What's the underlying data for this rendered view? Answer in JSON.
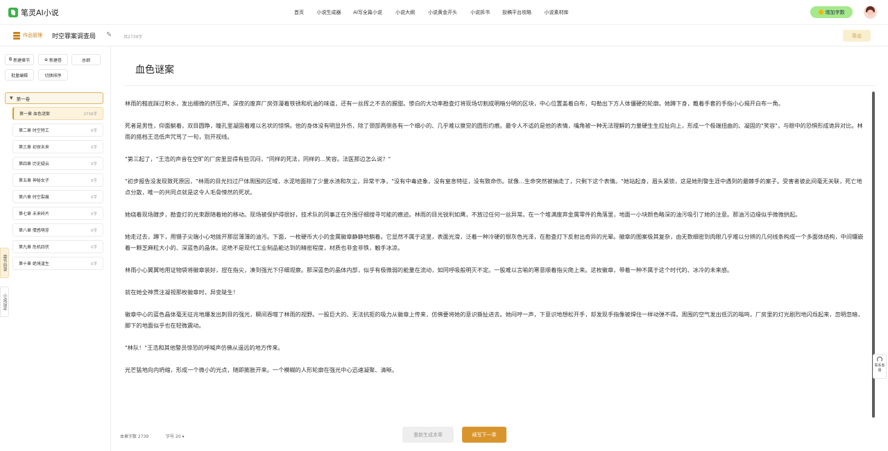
{
  "app": {
    "name": "笔灵AI小说"
  },
  "nav": {
    "items": [
      "首页",
      "小说生成器",
      "AI写全篇小说",
      "小说大纲",
      "小说黄金开头",
      "小说拆书",
      "投稿平台攻略",
      "小说素材库"
    ],
    "upgrade_label": "增加字数"
  },
  "subheader": {
    "crumb": "作品管理",
    "book_title": "时空罪案调查局",
    "total": "共2739字",
    "export": "导出"
  },
  "sidebar": {
    "buttons": [
      "新建章节",
      "新建卷",
      "总纲",
      "批量编辑",
      "切换排序"
    ],
    "volume": "第一卷",
    "chapters": [
      {
        "name": "第一章 血色谜案",
        "count": "2739字"
      },
      {
        "name": "第二章 时空特工",
        "count": "0字"
      },
      {
        "name": "第三章 初探未来",
        "count": "0字"
      },
      {
        "name": "第四章 历史疑云",
        "count": "0字"
      },
      {
        "name": "第五章 神秘女子",
        "count": "0字"
      },
      {
        "name": "第六章 时空裂痕",
        "count": "0字"
      },
      {
        "name": "第七章 未来碎片",
        "count": "0字"
      },
      {
        "name": "第八章 情感萌芽",
        "count": "0字"
      },
      {
        "name": "第九章 危机四伏",
        "count": "0字"
      },
      {
        "name": "第十章 绝境逢生",
        "count": "0字"
      }
    ],
    "tabs": [
      "章节目录",
      "小说设定"
    ]
  },
  "editor": {
    "title": "血色谜案",
    "paragraphs": [
      "林雨的鞋底踩过积水，发出细微的挤压声。深夜的废弃厂房弥漫着铁锈和机油的味道，还有一丝挥之不去的腥甜。惨白的大功率勘查灯将现场切割成明暗分明的区块，中心位置盖着白布，勾勒出下方人体僵硬的轮廓。她蹲下身，戴着手套的手指小心揭开白布一角。",
      "死者是男性，仰面躺着，双目圆睁，瞳孔里凝固着难以名状的惊惧。他的身体没有明显外伤，除了颈部两侧各有一个细小的、几乎难以察觉的圆形灼痕。最令人不适的是他的表情，嘴角被一种无法理解的力量硬生生拉扯向上，形成一个极端扭曲的、凝固的\"笑容\"，与眼中的恐惧形成诡异对比。林雨的搭档王浩低声咒骂了一句，别开视线。",
      "\"第三起了，\"王浩的声音在空旷的厂房里显得有些沉闷，\"同样的死法，同样的...笑容。法医那边怎么说？\"",
      "\"初步报告没发现致死原因，\"林雨的目光扫过尸体周围的区域，水泥地面除了少量水渍和灰尘，异常干净，\"没有中毒迹象，没有窒息特征，没有致命伤。就像...生命突然被抽走了，只剩下这个表情。\"她站起身，眉头紧锁，这是她刑警生涯中遇到的最棘手的案子。受害者彼此间毫无关联，死亡地点分散，唯一的共同点就是这令人毛骨悚然的死状。",
      "她绕着现场踱步，勘查灯的光束跟随着她的移动。现场被保护得很好，技术队的同事正在外围仔细搜寻可能的痕迹。林雨的目光锐利如鹰，不放过任何一丝异常。在一个堆满废弃金属零件的角落里，地面一小块颜色略深的油污吸引了她的注意。那油污边缘似乎微微拱起。",
      "她走过去，蹲下，用镊子尖端小心地拨开那层薄薄的油污。下面，一枚硬币大小的金属徽章静静地躺着。它显然不属于这里，表面光滑，泛着一种冷硬的银灰色光泽，在勘查灯下反射出奇异的光晕。徽章的图案极其复杂，由无数细密到肉眼几乎难以分辨的几何线条构成一个多面体结构，中间镶嵌着一颗芝麻粒大小的、深蓝色的晶体。这绝不是现代工业制品能达到的精密程度，材质也非金非铁，触手冰凉。",
      "林雨小心翼翼地用证物袋将徽章装好，捏在指尖，凑到强光下仔细观察。那深蓝色的晶体内部，似乎有极微弱的能量在流动，如同呼吸般明灭不定。一股难以言喻的寒意顺着指尖爬上来。这枚徽章，带着一种不属于这个时代的、冰冷的未来感。",
      "就在她全神贯注凝视那枚徽章时，异变陡生！",
      "徽章中心的蓝色晶体毫无征兆地爆发出刺目的强光，瞬间吞噬了林雨的视野。一股巨大的、无法抗拒的吸力从徽章上传来，仿佛要将她的意识撕扯进去。她闷哼一声，下意识地想松开手，却发现手指像被焊住一样动弹不得。周围的空气发出低沉的嗡鸣，厂房里的灯光剧烈地闪烁起来，忽明忽暗，脚下的地面似乎也在轻微震动。",
      "\"林队！\"王浩和其他警员惊恐的呼喊声仿佛从遥远的地方传来。",
      "光芒猛地向内坍缩，形成一个微小的光点，随即膨胀开来。一个模糊的人形轮廓在强光中心迅速凝聚、清晰。"
    ]
  },
  "footer": {
    "word_count": "本章字数 2739",
    "font_size": "字号 20",
    "regenerate": "重新生成本章",
    "continue": "续写下一章"
  },
  "service": {
    "label": "联系客服"
  }
}
